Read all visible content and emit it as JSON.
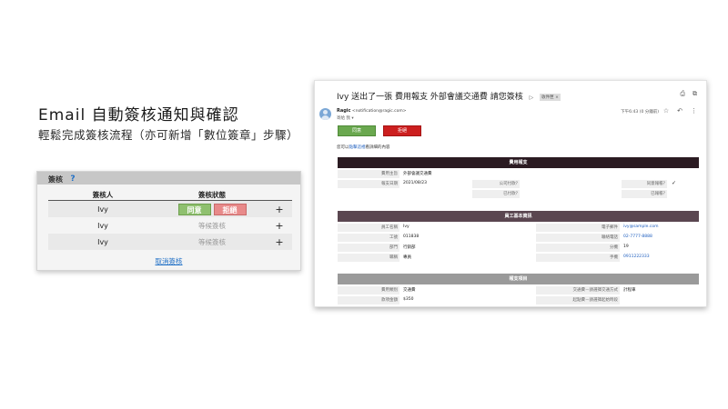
{
  "headline": "Email 自動簽核通知與確認",
  "subline": "輕鬆完成簽核流程（亦可新增「數位簽章」步驟）",
  "signoff": {
    "title": "簽核",
    "help_glyph": "?",
    "col_approver": "簽核人",
    "col_status": "簽核狀態",
    "rows": [
      {
        "name": "Ivy",
        "state": "buttons",
        "status_text": ""
      },
      {
        "name": "Ivy",
        "state": "waiting",
        "status_text": "等候簽核"
      },
      {
        "name": "Ivy",
        "state": "waiting",
        "status_text": "等候簽核"
      }
    ],
    "agree_label": "同意",
    "reject_label": "拒絕",
    "plus_glyph": "+",
    "cancel_label": "取消簽核"
  },
  "email": {
    "subject": "Ivy 送出了一張 費用報支 外部會議交通費 請您簽核",
    "inbox_tag": "收件匣 ×",
    "sender_name": "Ragic",
    "sender_addr": "<notification@ragic.com>",
    "to_line": "寄給 我 ▾",
    "time": "下午6:43 (0 分鐘前)",
    "agree_label": "同意",
    "reject_label": "拒絕",
    "detail_prefix": "您可以",
    "detail_link": "點擊這裡",
    "detail_suffix": "看詳細的內容",
    "sections": {
      "expense": "費用報支",
      "employee": "員工基本資訊",
      "items": "報支項目"
    },
    "expense_fields": {
      "subject_label": "費用主旨",
      "subject_value": "外部會議交通費",
      "date_label": "報支日期",
      "date_value": "2021/08/23",
      "company_approved_label": "公司付款?",
      "paid_label": "已付款?",
      "agreed_label": "同意報帳?",
      "agreed_value": "✓",
      "reported_label": "已報帳?"
    },
    "employee_fields": {
      "name_label": "員工名稱",
      "name_value": "Ivy",
      "id_label": "工號",
      "id_value": "011838",
      "dept_label": "部門",
      "dept_value": "行銷部",
      "title_label": "職稱",
      "title_value": "專員",
      "email_label": "電子郵件",
      "email_value": "ivy@sample.com",
      "phone_label": "聯絡電話",
      "phone_value": "02-7777-8888",
      "ext_label": "分機",
      "ext_value": "19",
      "mobile_label": "手機",
      "mobile_value": "0911222333"
    },
    "item_fields": {
      "type_label": "費用類別",
      "type_value": "交通費",
      "amount_label": "款項金額",
      "amount_value": "$350",
      "method_label": "交通費－請選擇交通方式",
      "method_value": "計程車",
      "start_label": "起點費－請選擇起始時段",
      "start_value": ""
    }
  },
  "colors": {
    "agree_green": "#6aa84f",
    "reject_red": "#cc1f1f",
    "section_dark": "#2b1b22",
    "section_mid": "#5a4650",
    "section_gray": "#9a9a9a",
    "link_blue": "#1f5fbf"
  },
  "icons": [
    "help-icon",
    "tag-icon",
    "print-icon",
    "open-new-window-icon",
    "avatar-icon",
    "star-icon",
    "reply-icon",
    "more-icon",
    "plus-icon"
  ]
}
